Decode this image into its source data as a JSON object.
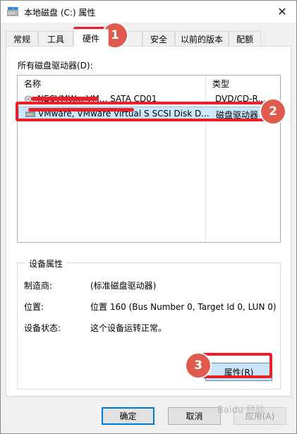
{
  "window": {
    "title": "本地磁盘 (C:) 属性",
    "close_glyph": "✕"
  },
  "tabs": [
    {
      "label": "常规",
      "active": false
    },
    {
      "label": "工具",
      "active": false
    },
    {
      "label": "硬件",
      "active": true
    },
    {
      "label": "安全",
      "active": false
    },
    {
      "label": "以前的版本",
      "active": false
    },
    {
      "label": "配额",
      "active": false
    }
  ],
  "drives_label": "所有磁盘驱动器(D):",
  "list": {
    "columns": {
      "name": "名称",
      "type": "类型"
    },
    "rows": [
      {
        "name": "NECVMW... VM... SATA CD01",
        "type": "DVD/CD-R...",
        "icon": "cd-drive-icon",
        "selected": false
      },
      {
        "name": "VMware, VMware Virtual S SCSI Disk D...",
        "type": "磁盘驱动器",
        "icon": "hard-disk-icon",
        "selected": true
      }
    ]
  },
  "device_properties": {
    "title": "设备属性",
    "manufacturer_label": "制造商:",
    "manufacturer_value": "(标准磁盘驱动器)",
    "location_label": "位置:",
    "location_value": "位置 160 (Bus Number 0, Target Id 0, LUN 0)",
    "status_label": "设备状态:",
    "status_value": "这个设备运转正常。",
    "properties_button": "属性(R)"
  },
  "footer": {
    "ok": "确定",
    "cancel": "取消",
    "apply": "应用(A)"
  },
  "annotations": {
    "badge1": "1",
    "badge2": "2",
    "badge3": "3",
    "color": "#e8202a"
  },
  "watermark": "Baidu 经验"
}
